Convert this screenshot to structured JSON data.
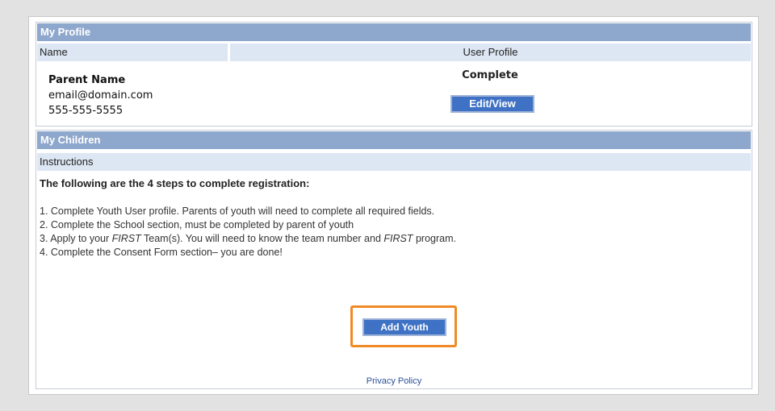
{
  "profile": {
    "header": "My Profile",
    "col_name": "Name",
    "col_user_profile": "User Profile",
    "parent_name": "Parent Name",
    "email": "email@domain.com",
    "phone": "555-555-5555",
    "status": "Complete",
    "edit_button": "Edit/View"
  },
  "children": {
    "header": "My Children",
    "instructions_label": "Instructions",
    "steps_heading": "The following are the 4 steps to complete registration:",
    "steps": {
      "s1": "1. Complete Youth User profile. Parents of youth will need to complete all required fields.",
      "s2": "2. Complete the School section, must be completed by parent of youth",
      "s3_pre": "3. Apply to your ",
      "s3_em1": "FIRST",
      "s3_mid": " Team(s). You will need to know the team number and ",
      "s3_em2": "FIRST",
      "s3_post": " program.",
      "s4": "4. Complete the Consent Form section– you are done!"
    },
    "add_button": "Add Youth"
  },
  "footer": {
    "privacy_link": "Privacy Policy"
  },
  "colors": {
    "section_header": "#8ea7cc",
    "subheader": "#dde7f3",
    "button": "#3f72c4",
    "highlight": "#f08a24"
  }
}
